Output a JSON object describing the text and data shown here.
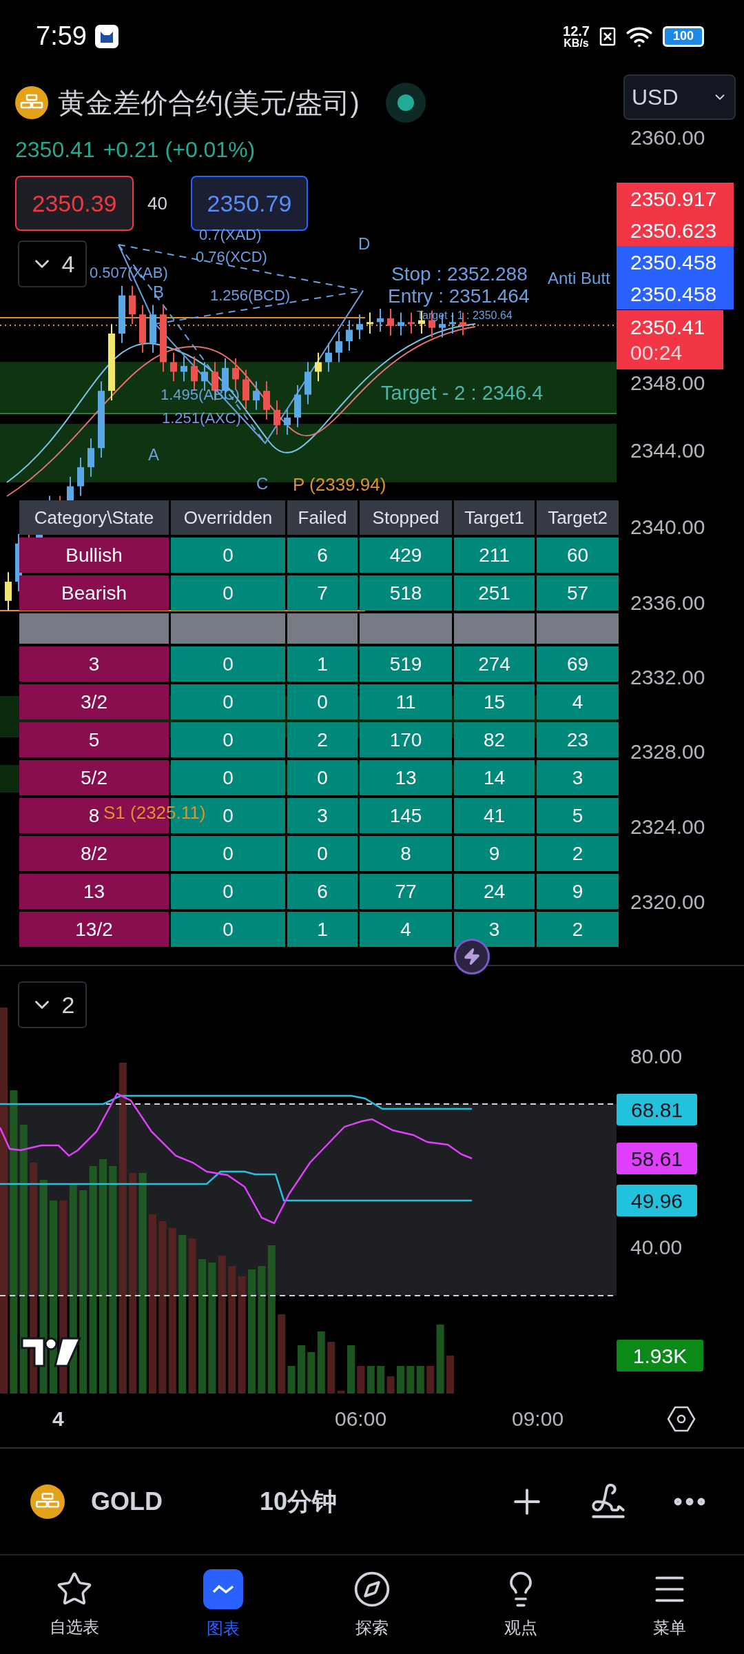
{
  "status_bar": {
    "time": "7:59",
    "speed_value": "12.7",
    "speed_unit": "KB/s",
    "battery": "100"
  },
  "header": {
    "title": "黄金差价合约(美元/盎司)",
    "currency": "USD"
  },
  "quote": {
    "last": "2350.41",
    "change": "+0.21 (+0.01%)"
  },
  "trade": {
    "sell": "2350.39",
    "spread": "40",
    "buy": "2350.79"
  },
  "main_toggle": {
    "count": "4"
  },
  "annotations": [
    {
      "text": "0.7(XAD)",
      "kind": "ratio"
    },
    {
      "text": "D",
      "kind": "point"
    },
    {
      "text": "0.76(XCD)",
      "kind": "ratio"
    },
    {
      "text": "0.507(XAB)",
      "kind": "ratio"
    },
    {
      "text": "Stop : 2352.288",
      "kind": "level"
    },
    {
      "text": "Anti Butt",
      "kind": "level_small"
    },
    {
      "text": "B",
      "kind": "point"
    },
    {
      "text": "1.256(BCD)",
      "kind": "ratio"
    },
    {
      "text": "Entry : 2351.464",
      "kind": "level"
    },
    {
      "text": "Target - 1 : 2350.64",
      "kind": "level_tiny"
    },
    {
      "text": "1.495(ABC)",
      "kind": "ratio"
    },
    {
      "text": "Target - 2 : 2346.4",
      "kind": "target"
    },
    {
      "text": "1.251(AXC)",
      "kind": "ratio"
    },
    {
      "text": "A",
      "kind": "point"
    },
    {
      "text": "C",
      "kind": "point"
    },
    {
      "text": "P (2339.94)",
      "kind": "pivot"
    },
    {
      "text": "S1 (2325.11)",
      "kind": "pivot"
    }
  ],
  "price_axis": {
    "ticks": [
      "2360.00",
      "2348.00",
      "2344.00",
      "2340.00",
      "2336.00",
      "2332.00",
      "2328.00",
      "2324.00",
      "2320.00"
    ],
    "tags": [
      {
        "text": "2350.917",
        "color": "#f23645"
      },
      {
        "text": "2350.623",
        "color": "#f23645"
      },
      {
        "text": "2350.458",
        "color": "#2962ff"
      },
      {
        "text": "2350.458",
        "color": "#2962ff"
      }
    ],
    "last_tag": {
      "price": "2350.41",
      "countdown": "00:24",
      "color": "#f23645"
    }
  },
  "stats_table": {
    "columns": [
      "Category\\State",
      "Overridden",
      "Failed",
      "Stopped",
      "Target1",
      "Target2"
    ],
    "rows": [
      {
        "kind": "data",
        "cells": [
          "Bullish",
          "0",
          "6",
          "429",
          "211",
          "60"
        ]
      },
      {
        "kind": "data",
        "cells": [
          "Bearish",
          "0",
          "7",
          "518",
          "251",
          "57"
        ]
      },
      {
        "kind": "separator"
      },
      {
        "kind": "data",
        "cells": [
          "3",
          "0",
          "1",
          "519",
          "274",
          "69"
        ]
      },
      {
        "kind": "data",
        "cells": [
          "3/2",
          "0",
          "0",
          "11",
          "15",
          "4"
        ]
      },
      {
        "kind": "data",
        "cells": [
          "5",
          "0",
          "2",
          "170",
          "82",
          "23"
        ]
      },
      {
        "kind": "data",
        "cells": [
          "5/2",
          "0",
          "0",
          "13",
          "14",
          "3"
        ]
      },
      {
        "kind": "data",
        "cells": [
          "8",
          "0",
          "3",
          "145",
          "41",
          "5"
        ]
      },
      {
        "kind": "data",
        "cells": [
          "8/2",
          "0",
          "0",
          "8",
          "9",
          "2"
        ]
      },
      {
        "kind": "data",
        "cells": [
          "13",
          "0",
          "6",
          "77",
          "24",
          "9"
        ]
      },
      {
        "kind": "data",
        "cells": [
          "13/2",
          "0",
          "1",
          "4",
          "3",
          "2"
        ]
      }
    ]
  },
  "oscillator": {
    "count": "2",
    "ticks": [
      "80.00",
      "40.00"
    ],
    "tags": [
      {
        "text": "68.81",
        "color": "#22c1dc"
      },
      {
        "text": "58.61",
        "color": "#e040fb"
      },
      {
        "text": "49.96",
        "color": "#22c1dc"
      }
    ],
    "volume_tag": "1.93K"
  },
  "time_axis": [
    "4",
    "06:00",
    "09:00"
  ],
  "symbol_bar": {
    "symbol": "GOLD",
    "interval": "10分钟"
  },
  "nav": [
    {
      "label": "自选表",
      "selected": false
    },
    {
      "label": "图表",
      "selected": true
    },
    {
      "label": "探索",
      "selected": false
    },
    {
      "label": "观点",
      "selected": false
    },
    {
      "label": "菜单",
      "selected": false
    }
  ]
}
